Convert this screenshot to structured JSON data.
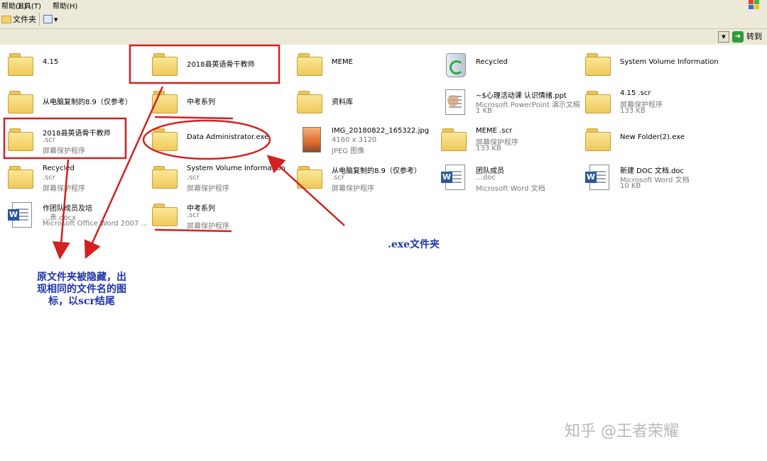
{
  "menu": {
    "items": [
      "帮助(H)",
      "工具(T)",
      "帮助(H)"
    ]
  },
  "toolbar": {
    "folders_label": "文件夹"
  },
  "addressbar": {
    "goto_label": "转到"
  },
  "files": [
    {
      "name": "4.15",
      "sub1": "",
      "sub2": "",
      "icon": "folder"
    },
    {
      "name": "2018县英语骨干教师",
      "sub1": "",
      "sub2": "",
      "icon": "folder"
    },
    {
      "name": "MEME",
      "sub1": "",
      "sub2": "",
      "icon": "folder"
    },
    {
      "name": "Recycled",
      "sub1": "",
      "sub2": "",
      "icon": "recycle-bin"
    },
    {
      "name": "System Volume Information",
      "sub1": "",
      "sub2": "",
      "icon": "folder"
    },
    {
      "name": "从电脑复制的8.9（仅参考）",
      "sub1": "",
      "sub2": "",
      "icon": "folder"
    },
    {
      "name": "中考系列",
      "sub1": "",
      "sub2": "",
      "icon": "folder"
    },
    {
      "name": "资料库",
      "sub1": "",
      "sub2": "",
      "icon": "folder"
    },
    {
      "name": "~$心理活动课 认识情绪.ppt",
      "sub1": "Microsoft PowerPoint 演示文稿",
      "sub2": "1 KB",
      "icon": "powerpoint"
    },
    {
      "name": "4.15                          .scr",
      "sub1": "屏幕保护程序",
      "sub2": "133 KB",
      "icon": "folder"
    },
    {
      "name": "2018县英语骨干教师",
      "sub1": ".scr",
      "sub2": "屏幕保护程序",
      "icon": "folder"
    },
    {
      "name": "Data Administrator.exe",
      "sub1": "",
      "sub2": "",
      "icon": "folder"
    },
    {
      "name": "IMG_20180822_165322.jpg",
      "sub1": "4160 x 3120",
      "sub2": "JPEG 图像",
      "icon": "image"
    },
    {
      "name": "MEME                          .scr",
      "sub1": "屏幕保护程序",
      "sub2": "133 KB",
      "icon": "folder"
    },
    {
      "name": "New Folder(2).exe",
      "sub1": "",
      "sub2": "",
      "icon": "folder"
    },
    {
      "name": "Recycled",
      "sub1": ".scr",
      "sub2": "屏幕保护程序",
      "icon": "folder"
    },
    {
      "name": "System Volume Information",
      "sub1": ".scr",
      "sub2": "屏幕保护程序",
      "icon": "folder"
    },
    {
      "name": "从电脑复制的8.9（仅参考）",
      "sub1": ".scr",
      "sub2": "屏幕保护程序",
      "icon": "folder"
    },
    {
      "name": "团队成员",
      "sub1": "…doc",
      "sub2": "Microsoft Word 文档",
      "icon": "word"
    },
    {
      "name": "新建 DOC 文档.doc",
      "sub1": "Microsoft Word 文档",
      "sub2": "10 KB",
      "icon": "word"
    },
    {
      "name": "作团队成员及培",
      "sub1": "…表.docx",
      "sub2": "Microsoft Office Word 2007 ...",
      "icon": "word"
    },
    {
      "name": "中考系列",
      "sub1": ".scr",
      "sub2": "屏幕保护程序",
      "icon": "folder"
    }
  ],
  "annotations": {
    "exe_label": ".exe文件夹",
    "hidden_note": [
      "原文件夹被隐藏，出",
      "现相同的文件名的图",
      "标，以scr结尾"
    ],
    "accent": "#d42020"
  },
  "watermark": "知乎 @王者荣耀"
}
